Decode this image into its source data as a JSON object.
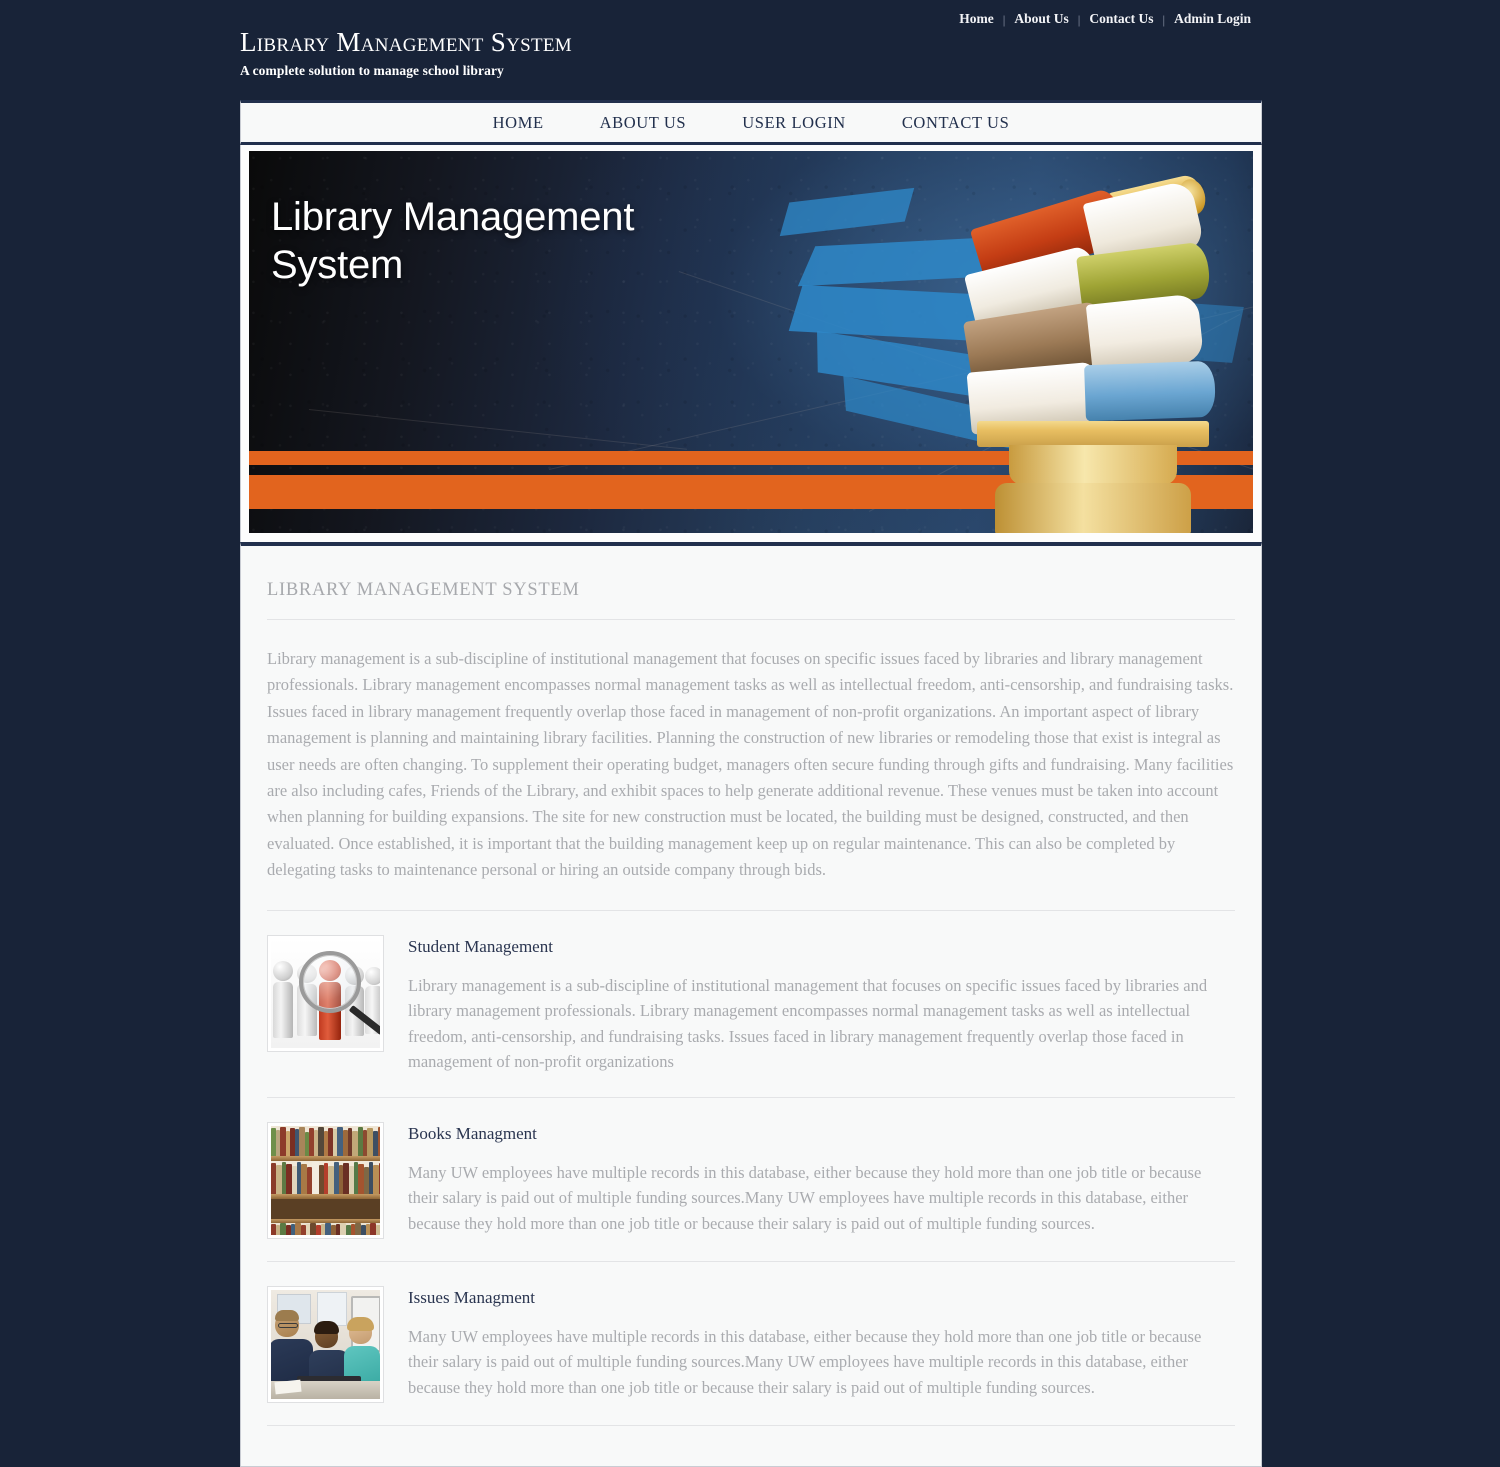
{
  "topbar": {
    "links": [
      {
        "label": "Home"
      },
      {
        "label": "About Us"
      },
      {
        "label": "Contact Us"
      },
      {
        "label": "Admin Login"
      }
    ],
    "separator": "|"
  },
  "brand": {
    "title": "Library Management System",
    "subtitle": "A complete solution to manage school library"
  },
  "nav": {
    "items": [
      {
        "label": "Home"
      },
      {
        "label": "About Us"
      },
      {
        "label": "User Login"
      },
      {
        "label": "Contact Us"
      }
    ]
  },
  "banner": {
    "title": "Library Management\nSystem",
    "image_alt": "stack-of-books-on-pedestal",
    "stripe_color": "#e2641e",
    "brush_color": "#2e88c8"
  },
  "main": {
    "section_heading": "Library Management System",
    "intro": "Library management is a sub-discipline of institutional management that focuses on specific issues faced by libraries and library management professionals. Library management encompasses normal management tasks as well as intellectual freedom, anti-censorship, and fundraising tasks. Issues faced in library management frequently overlap those faced in management of non-profit organizations. An important aspect of library management is planning and maintaining library facilities. Planning the construction of new libraries or remodeling those that exist is integral as user needs are often changing. To supplement their operating budget, managers often secure funding through gifts and fundraising. Many facilities are also including cafes, Friends of the Library, and exhibit spaces to help generate additional revenue. These venues must be taken into account when planning for building expansions. The site for new construction must be located, the building must be designed, constructed, and then evaluated. Once established, it is important that the building management keep up on regular maintenance. This can also be completed by delegating tasks to maintenance personal or hiring an outside company through bids.",
    "features": [
      {
        "title": "Student Management",
        "text": "Library management is a sub-discipline of institutional management that focuses on specific issues faced by libraries and library management professionals. Library management encompasses normal management tasks as well as intellectual freedom, anti-censorship, and fundraising tasks. Issues faced in library management frequently overlap those faced in management of non-profit organizations",
        "thumb_alt": "magnifying-glass-over-people-thumbnail"
      },
      {
        "title": "Books Managment",
        "text": "Many UW employees have multiple records in this database, either because they hold more than one job title or because their salary is paid out of multiple funding sources.Many UW employees have multiple records in this database, either because they hold more than one job title or because their salary is paid out of multiple funding sources.",
        "thumb_alt": "bookshelf-thumbnail"
      },
      {
        "title": "Issues Managment",
        "text": "Many UW employees have multiple records in this database, either because they hold more than one job title or because their salary is paid out of multiple funding sources.Many UW employees have multiple records in this database, either because they hold more than one job title or because their salary is paid out of multiple funding sources.",
        "thumb_alt": "people-at-computer-thumbnail"
      }
    ]
  },
  "theme": {
    "page_background": "#182338",
    "panel_background": "#f8f9f9",
    "accent_navy": "#22304d",
    "muted_text": "#a9abaf"
  }
}
